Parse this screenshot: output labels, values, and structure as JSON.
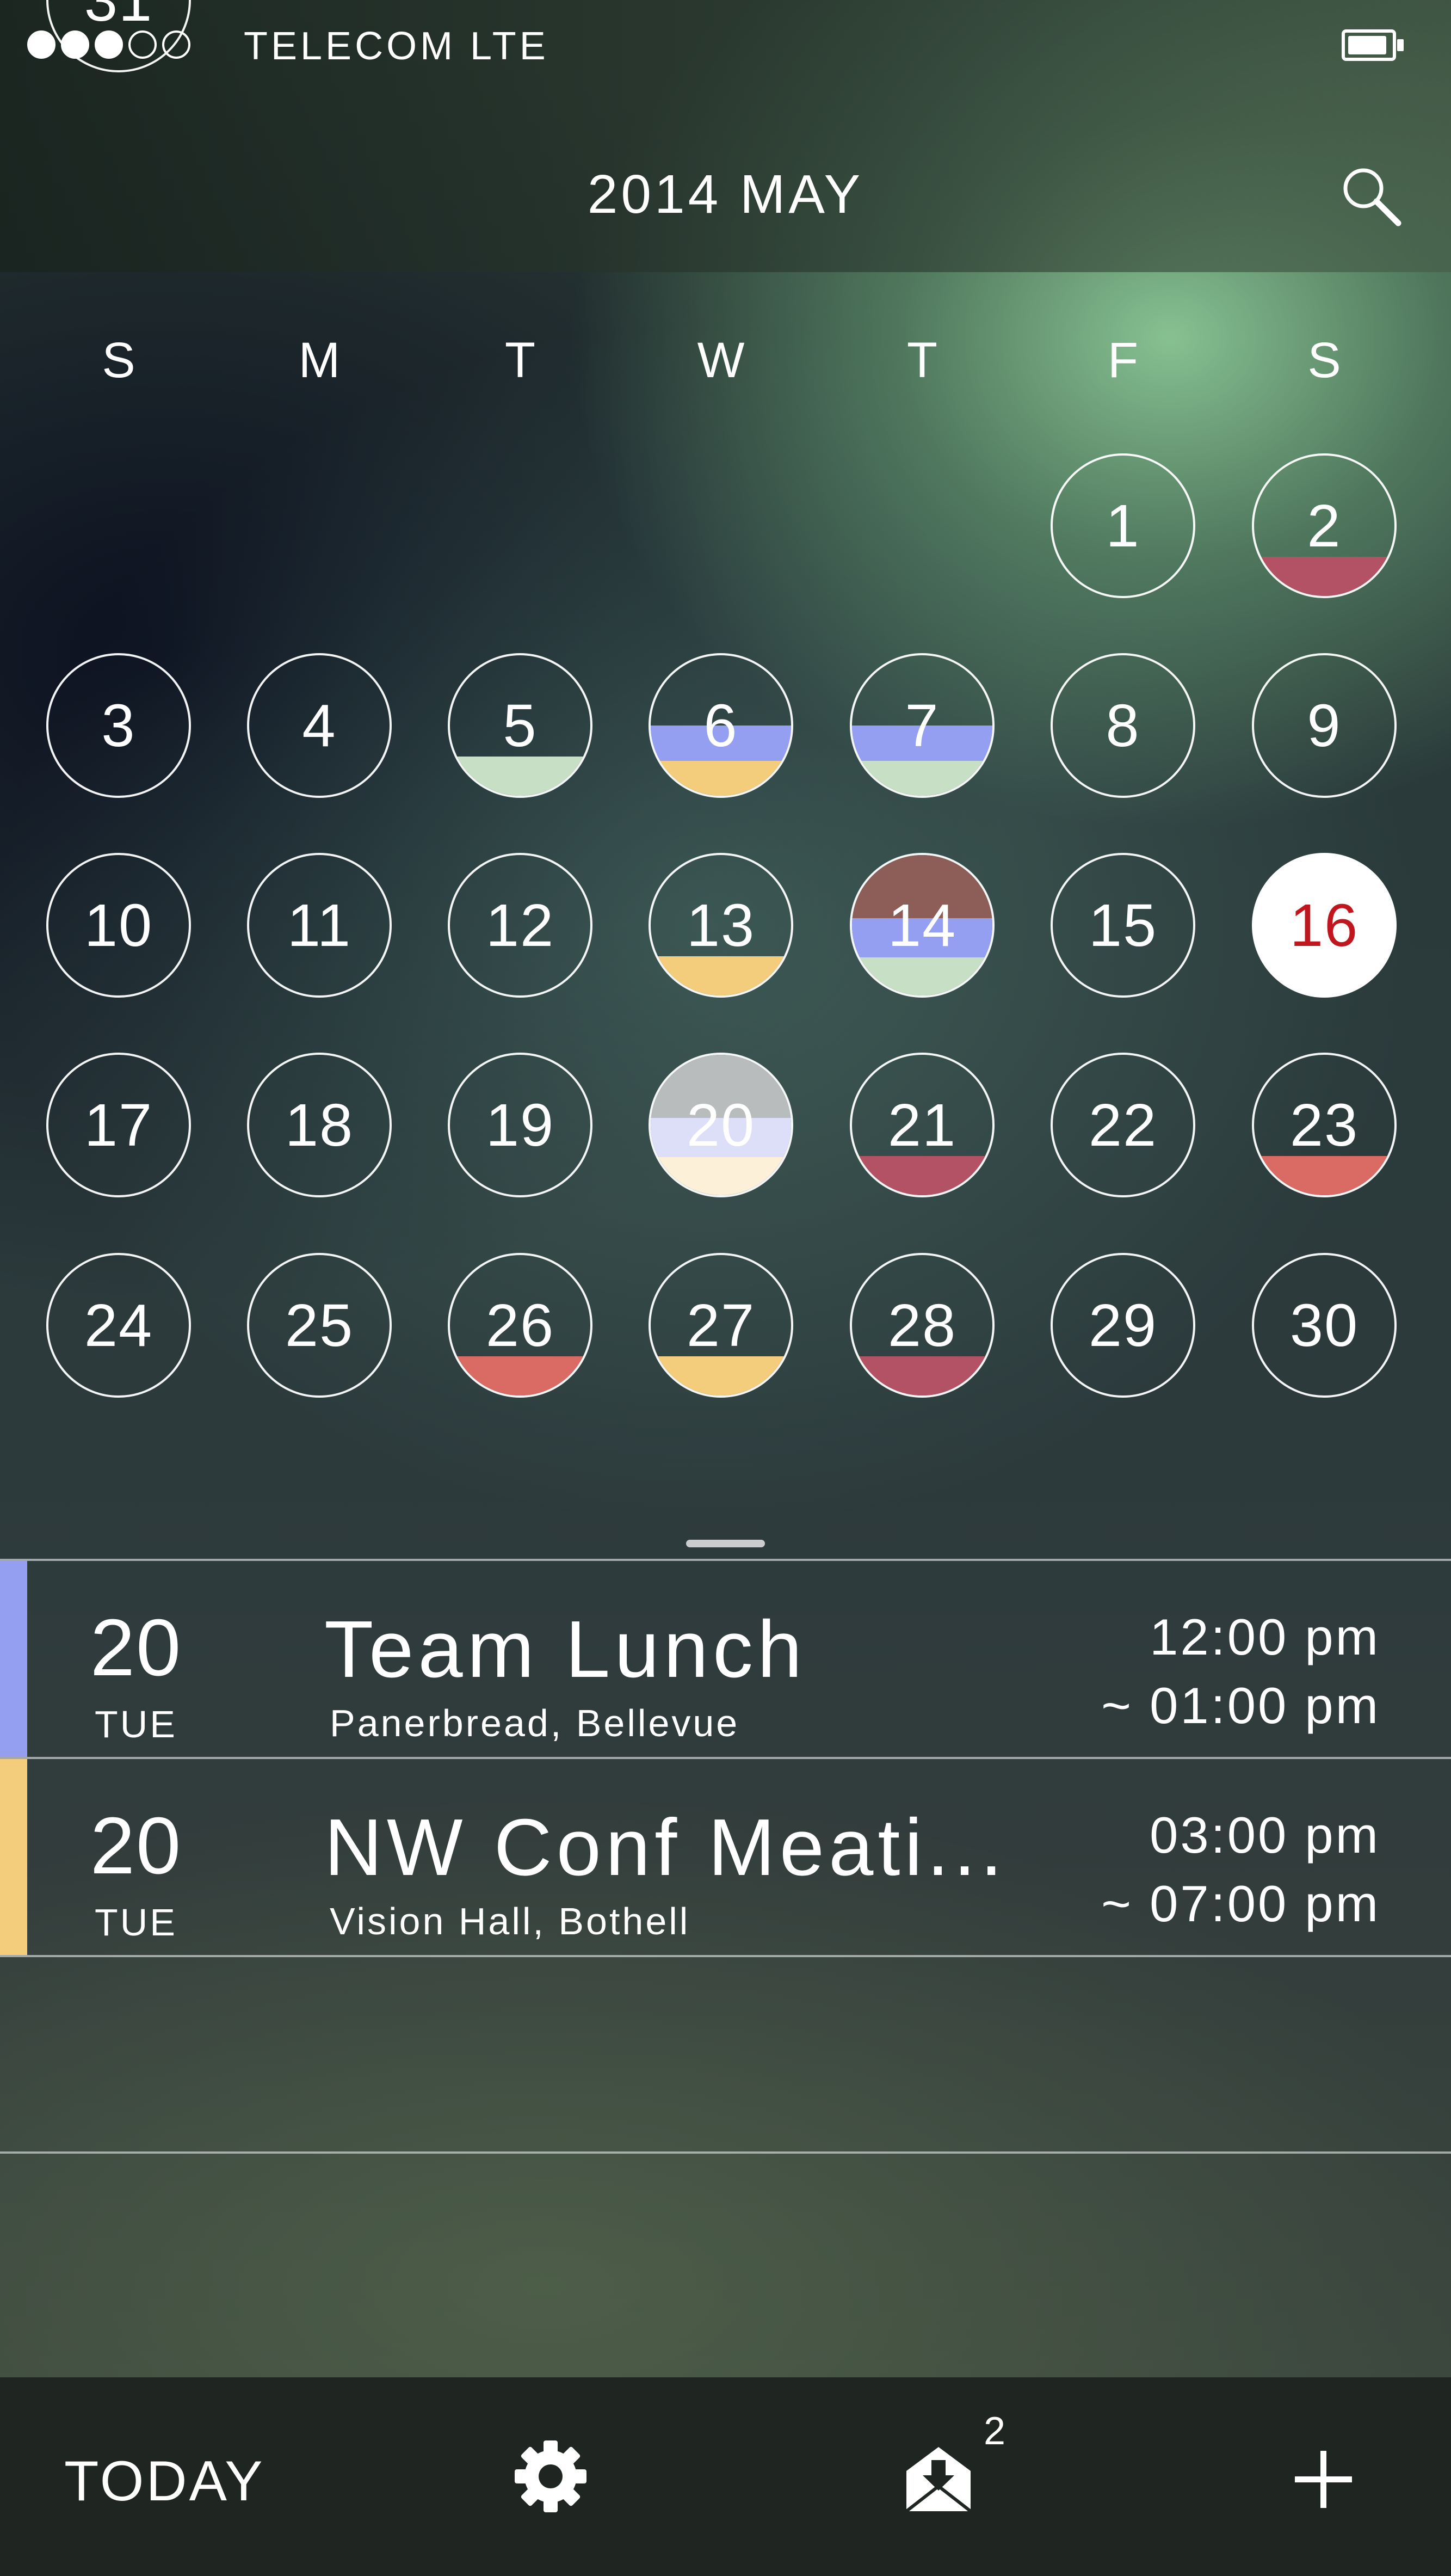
{
  "status_bar": {
    "signal_total": 5,
    "signal_filled": 3,
    "carrier": "TELECOM  LTE",
    "battery_icon": "battery-icon"
  },
  "header": {
    "title": "2014 MAY",
    "search_icon": "search-icon"
  },
  "weekdays": [
    "S",
    "M",
    "T",
    "W",
    "T",
    "F",
    "S"
  ],
  "calendar": {
    "today": 16,
    "first_weekday_index": 5,
    "days_in_month": 31,
    "event_colors": {
      "red": "#b45265",
      "coral": "#d96b64",
      "mint": "#c7dfc5",
      "periwinkle": "#959ff2",
      "amber": "#f3cc7c",
      "brown": "#8c5e57",
      "gray": "#b9bcbd",
      "lavender": "#dcdff7",
      "cream": "#fdf0d8"
    },
    "day_bands": {
      "2": [
        "red"
      ],
      "5": [
        "mint"
      ],
      "6": [
        "periwinkle",
        "amber"
      ],
      "7": [
        "periwinkle",
        "mint"
      ],
      "13": [
        "amber"
      ],
      "14": [
        "brown",
        "periwinkle",
        "mint"
      ],
      "20": [
        "gray",
        "lavender",
        "cream"
      ],
      "21": [
        "red"
      ],
      "23": [
        "coral"
      ],
      "26": [
        "coral"
      ],
      "27": [
        "amber"
      ],
      "28": [
        "red"
      ]
    }
  },
  "events": [
    {
      "date": "20",
      "weekday": "TUE",
      "title": "Team Lunch",
      "location": "Panerbread, Bellevue",
      "start": "12:00 pm",
      "end": "~  01:00 pm",
      "color": "#959ff2"
    },
    {
      "date": "20",
      "weekday": "TUE",
      "title": "NW Conf Meati...",
      "location": "Vision Hall, Bothell",
      "start": "03:00 pm",
      "end": "~  07:00 pm",
      "color": "#f3cc7c"
    }
  ],
  "tab_bar": {
    "today_label": "TODAY",
    "settings_icon": "gear-icon",
    "inbox_icon": "inbox-download-icon",
    "inbox_badge": "2",
    "add_icon": "plus-icon"
  }
}
